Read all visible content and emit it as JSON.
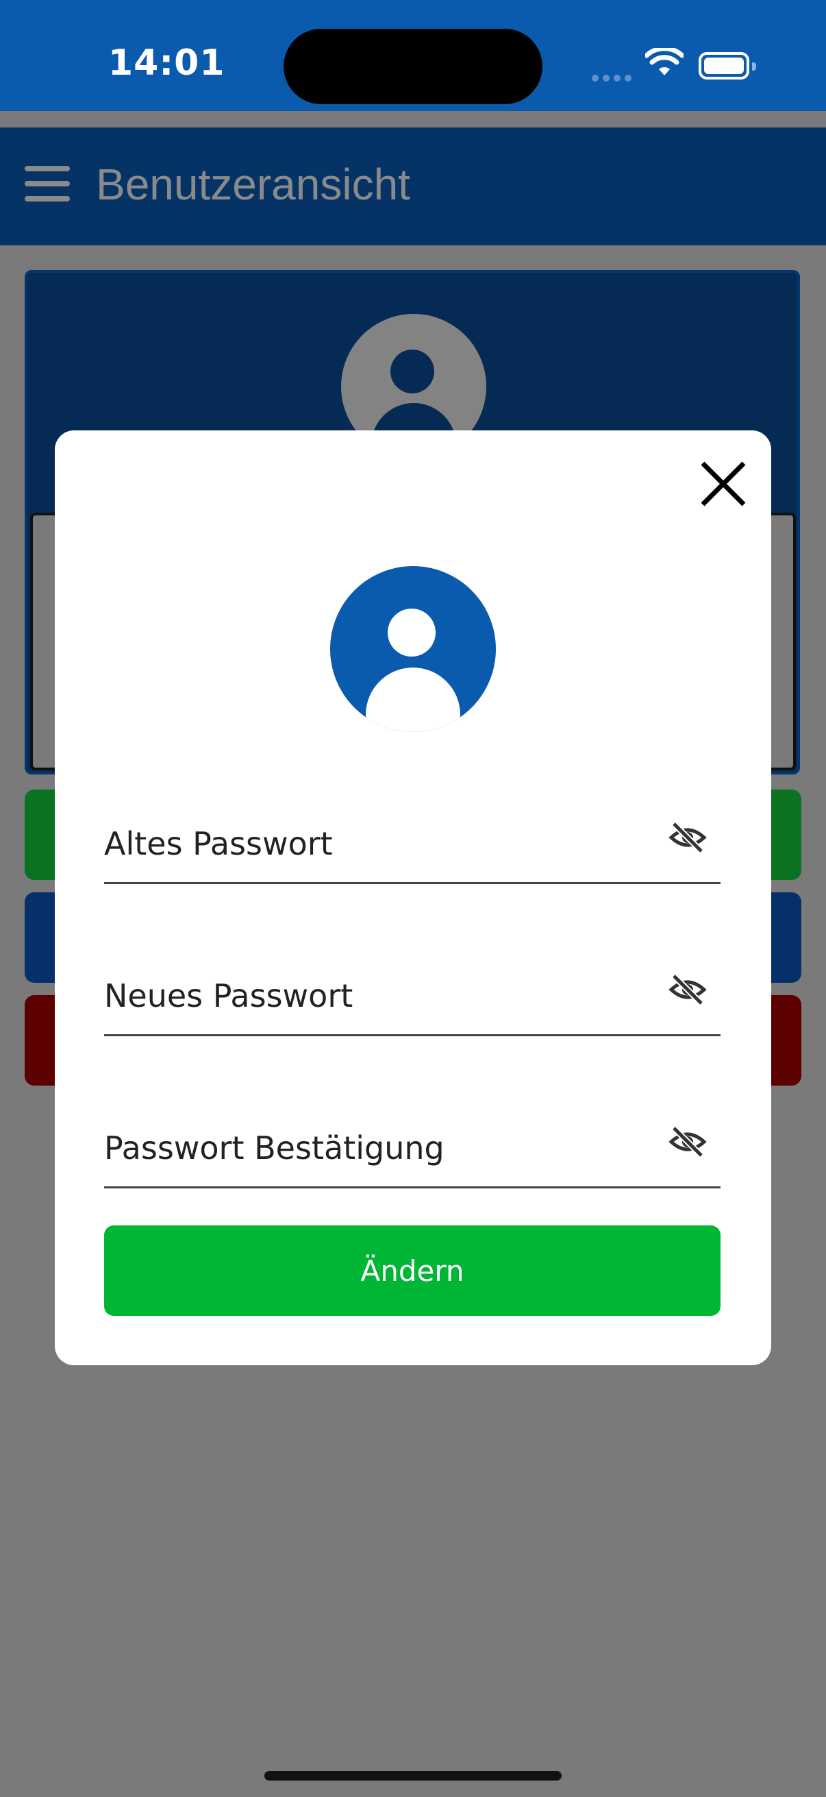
{
  "status_bar": {
    "time": "14:01",
    "icons": [
      "cellular-icon",
      "wifi-icon",
      "battery-icon"
    ]
  },
  "app_bar": {
    "title": "Benutzeransicht",
    "menu_icon": "hamburger-icon"
  },
  "modal": {
    "close_icon": "close-icon",
    "avatar_icon": "user-avatar-icon",
    "fields": [
      {
        "placeholder": "Altes Passwort",
        "value": "",
        "toggle_icon": "eye-off-icon"
      },
      {
        "placeholder": "Neues Passwort",
        "value": "",
        "toggle_icon": "eye-off-icon"
      },
      {
        "placeholder": "Passwort Bestätigung",
        "value": "",
        "toggle_icon": "eye-off-icon"
      }
    ],
    "submit_label": "Ändern"
  },
  "colors": {
    "status_bar": "#0a5bad",
    "app_bar": "#053366",
    "overlay": "#7a7a7a",
    "accent": "#0a5bad",
    "submit": "#00b635",
    "bg_green": "#0a7221",
    "bg_blue": "#05306a",
    "bg_red": "#5c0000"
  }
}
